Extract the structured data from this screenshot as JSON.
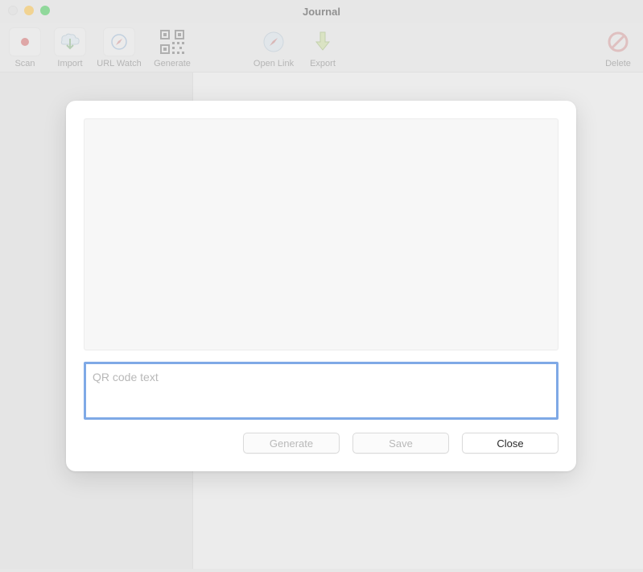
{
  "window": {
    "title": "Journal"
  },
  "toolbar": {
    "scan": "Scan",
    "import": "Import",
    "urlwatch": "URL Watch",
    "generate": "Generate",
    "openlink": "Open Link",
    "export": "Export",
    "delete": "Delete"
  },
  "modal": {
    "input_placeholder": "QR code text",
    "input_value": "",
    "generate": "Generate",
    "save": "Save",
    "close": "Close"
  }
}
